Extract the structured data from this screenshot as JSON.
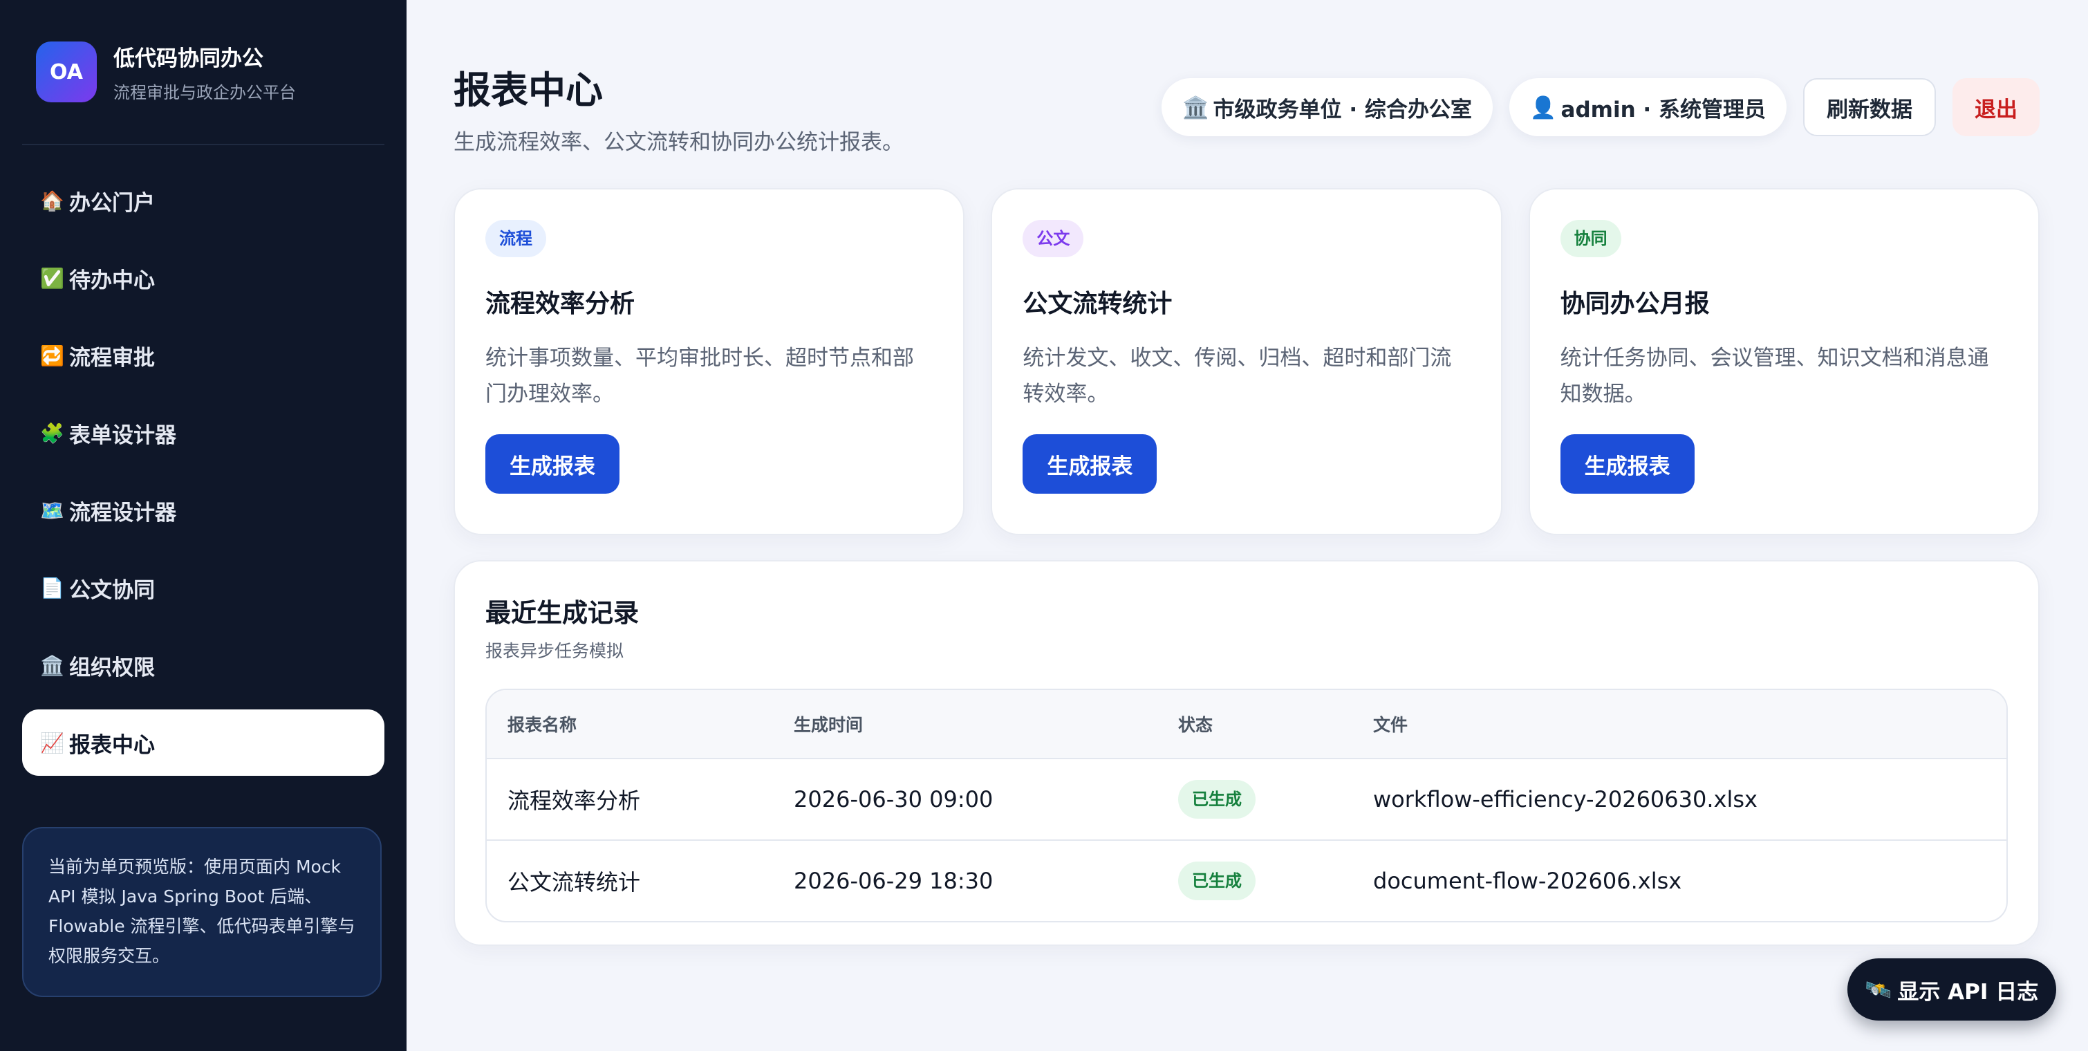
{
  "brand": {
    "logo": "OA",
    "title": "低代码协同办公",
    "subtitle": "流程审批与政企办公平台"
  },
  "nav": [
    {
      "icon": "🏠",
      "icon_name": "home-icon",
      "label": "办公门户",
      "active": false
    },
    {
      "icon": "✅",
      "icon_name": "check-icon",
      "label": "待办中心",
      "active": false
    },
    {
      "icon": "🔁",
      "icon_name": "repeat-icon",
      "label": "流程审批",
      "active": false
    },
    {
      "icon": "🧩",
      "icon_name": "puzzle-icon",
      "label": "表单设计器",
      "active": false
    },
    {
      "icon": "🗺️",
      "icon_name": "map-icon",
      "label": "流程设计器",
      "active": false
    },
    {
      "icon": "📄",
      "icon_name": "document-icon",
      "label": "公文协同",
      "active": false
    },
    {
      "icon": "🏛️",
      "icon_name": "institution-icon",
      "label": "组织权限",
      "active": false
    },
    {
      "icon": "📈",
      "icon_name": "chart-icon",
      "label": "报表中心",
      "active": true
    }
  ],
  "notice": "当前为单页预览版：使用页面内 Mock API 模拟 Java Spring Boot 后端、Flowable 流程引擎、低代码表单引擎与权限服务交互。",
  "header": {
    "title": "报表中心",
    "subtitle": "生成流程效率、公文流转和协同办公统计报表。",
    "org_icon": "🏛️",
    "org": "市级政务单位 · 综合办公室",
    "user_icon": "👤",
    "user": "admin · 系统管理员",
    "refresh_label": "刷新数据",
    "logout_label": "退出"
  },
  "cards": [
    {
      "tag": "流程",
      "tag_color": "#1d4ed8",
      "title": "流程效率分析",
      "desc": "统计事项数量、平均审批时长、超时节点和部门办理效率。",
      "button": "生成报表"
    },
    {
      "tag": "公文",
      "tag_color": "#7c3aed",
      "title": "公文流转统计",
      "desc": "统计发文、收文、传阅、归档、超时和部门流转效率。",
      "button": "生成报表"
    },
    {
      "tag": "协同",
      "tag_color": "#15803d",
      "title": "协同办公月报",
      "desc": "统计任务协同、会议管理、知识文档和消息通知数据。",
      "button": "生成报表"
    }
  ],
  "records": {
    "title": "最近生成记录",
    "subtitle": "报表异步任务模拟",
    "columns": [
      "报表名称",
      "生成时间",
      "状态",
      "文件"
    ],
    "rows": [
      {
        "name": "流程效率分析",
        "time": "2026-06-30 09:00",
        "status": "已生成",
        "file": "workflow-efficiency-20260630.xlsx"
      },
      {
        "name": "公文流转统计",
        "time": "2026-06-29 18:30",
        "status": "已生成",
        "file": "document-flow-202606.xlsx"
      }
    ]
  },
  "api_button": {
    "icon": "🛰️",
    "label": "显示 API 日志"
  },
  "colors": {
    "primary": "#1d4ed8",
    "sidebar_bg": "#0f1729",
    "danger": "#c81e1e",
    "success": "#15803d"
  }
}
